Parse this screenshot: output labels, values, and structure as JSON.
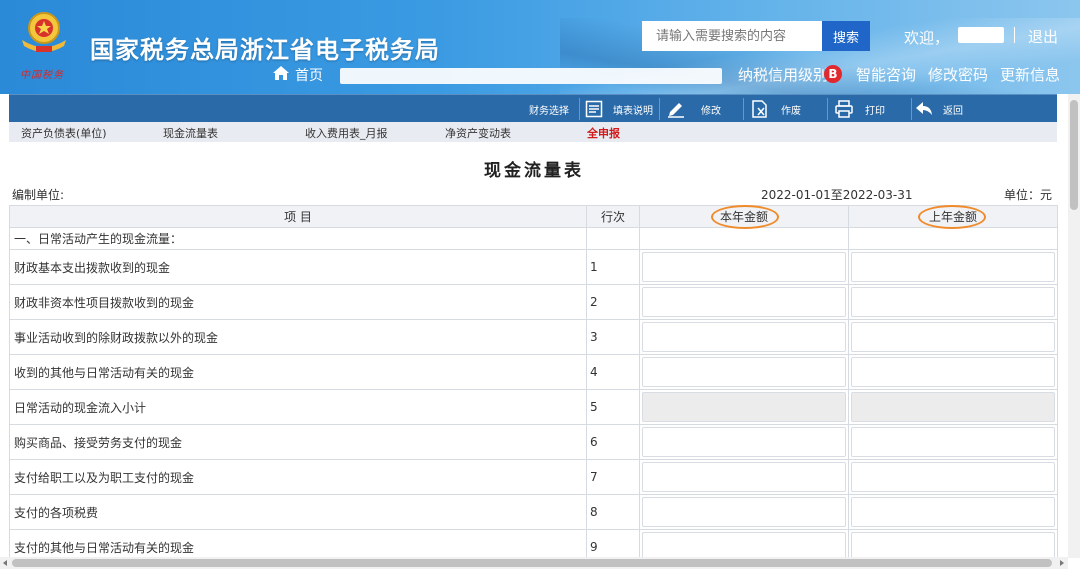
{
  "header": {
    "site_title": "国家税务总局浙江省电子税务局",
    "emblem_subtitle": "中国税务",
    "search": {
      "placeholder": "请输入需要搜索的内容",
      "button": "搜索"
    },
    "welcome": "欢迎，",
    "logout": "退出",
    "home": "首页",
    "links": {
      "credit": "纳税信用级别",
      "credit_badge": "B",
      "consult": "智能咨询",
      "change_password": "修改密码",
      "update_info": "更新信息"
    },
    "brand_color": "#2a8ad8"
  },
  "toolbar": {
    "finance_select": "财务选择",
    "fill_guide": "填表说明",
    "edit": "修改",
    "void": "作废",
    "print": "打印",
    "back": "返回"
  },
  "tabs": [
    {
      "label": "资产负债表(单位)"
    },
    {
      "label": "现金流量表"
    },
    {
      "label": "收入费用表_月报"
    },
    {
      "label": "净资产变动表"
    },
    {
      "label": "全申报"
    }
  ],
  "report": {
    "title": "现金流量表",
    "compiler_label": "编制单位:",
    "period": "2022-01-01至2022-03-31",
    "unit": "单位：元"
  },
  "table": {
    "headers": {
      "item": "项 目",
      "row": "行次",
      "current": "本年金额",
      "previous": "上年金额"
    },
    "section": "一、日常活动产生的现金流量：",
    "rows": [
      {
        "item": "财政基本支出拨款收到的现金",
        "no": "1"
      },
      {
        "item": "财政非资本性项目拨款收到的现金",
        "no": "2"
      },
      {
        "item": "事业活动收到的除财政拨款以外的现金",
        "no": "3"
      },
      {
        "item": "收到的其他与日常活动有关的现金",
        "no": "4"
      },
      {
        "item": "日常活动的现金流入小计",
        "no": "5"
      },
      {
        "item": "购买商品、接受劳务支付的现金",
        "no": "6"
      },
      {
        "item": "支付给职工以及为职工支付的现金",
        "no": "7"
      },
      {
        "item": "支付的各项税费",
        "no": "8"
      },
      {
        "item": "支付的其他与日常活动有关的现金",
        "no": "9"
      }
    ]
  },
  "accent_colors": {
    "toolbar": "#2a6aa8",
    "highlight_circle": "#f08b2c",
    "active_tab": "#d21a1a"
  }
}
